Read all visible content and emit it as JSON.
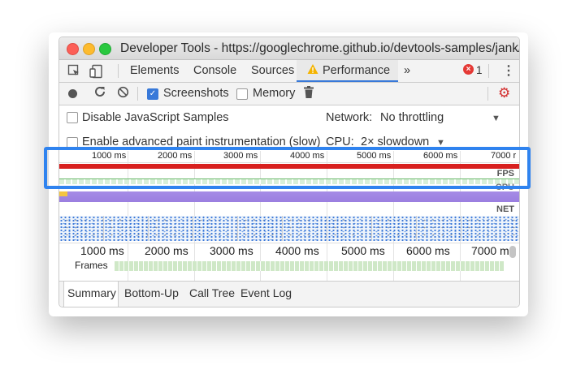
{
  "window": {
    "title": "Developer Tools - https://googlechrome.github.io/devtools-samples/jank/"
  },
  "tabs": [
    {
      "label": "Elements"
    },
    {
      "label": "Console"
    },
    {
      "label": "Sources"
    },
    {
      "label": "Performance",
      "active": true,
      "icon": "warning-icon"
    },
    {
      "label": "»"
    }
  ],
  "errors": {
    "count": "1",
    "icon": "error-icon"
  },
  "toolbar": {
    "screenshots_label": "Screenshots",
    "screenshots_checked": true,
    "memory_label": "Memory",
    "memory_checked": false,
    "icons": [
      "record-icon",
      "reload-icon",
      "clear-icon",
      "trash-icon",
      "gear-icon"
    ]
  },
  "settings": {
    "disable_js_label": "Disable JavaScript Samples",
    "paint_label": "Enable advanced paint instrumentation (slow)",
    "network_label": "Network:",
    "network_value": "No throttling",
    "cpu_label": "CPU:",
    "cpu_value": "2× slowdown"
  },
  "overview": {
    "ticks": [
      "1000 ms",
      "2000 ms",
      "3000 ms",
      "4000 ms",
      "5000 ms",
      "6000 ms",
      "7000 r"
    ],
    "fps_label": "FPS",
    "cpu_label": "CPU",
    "net_label": "NET"
  },
  "details": {
    "ticks": [
      "1000 ms",
      "2000 ms",
      "3000 ms",
      "4000 ms",
      "5000 ms",
      "6000 ms",
      "7000 m"
    ],
    "frames_label": "Frames"
  },
  "bottom_tabs": [
    {
      "label": "Summary",
      "active": true
    },
    {
      "label": "Bottom-Up"
    },
    {
      "label": "Call Tree"
    },
    {
      "label": "Event Log"
    }
  ],
  "colors": {
    "accent": "#3879d9",
    "highlight": "#2f83ef",
    "fps": "#d8201f",
    "cpu": "#9b7fe0"
  }
}
